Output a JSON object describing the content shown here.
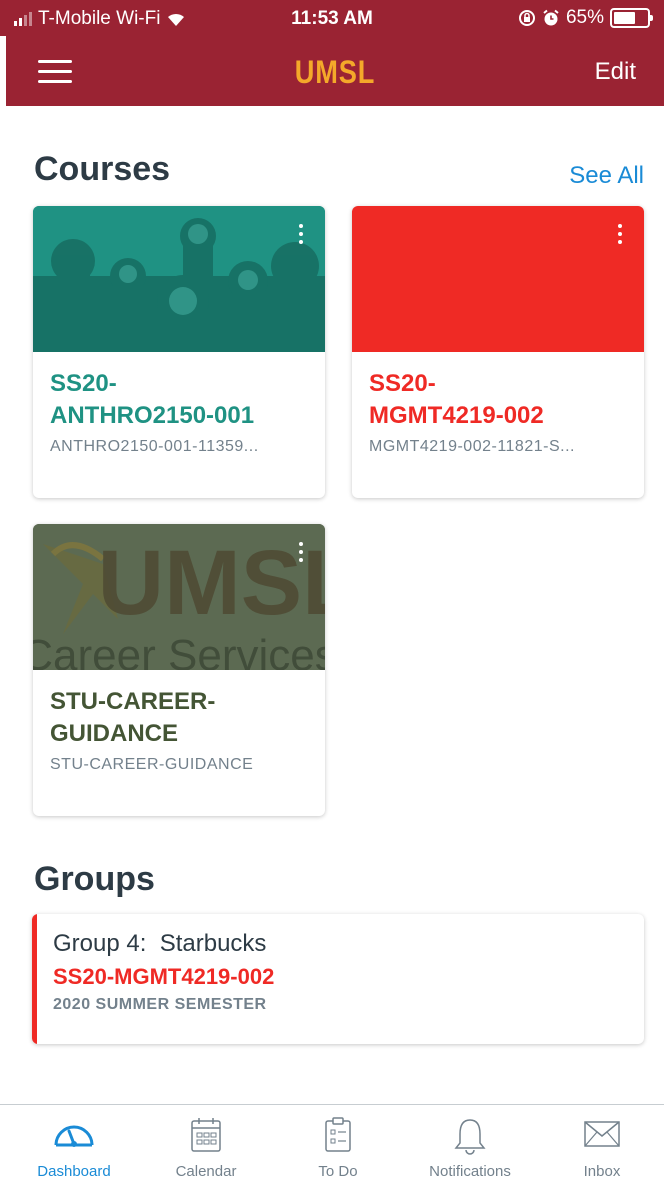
{
  "status_bar": {
    "carrier": "T-Mobile Wi-Fi",
    "time": "11:53 AM",
    "battery_percent": "65%",
    "battery_level": 0.65
  },
  "nav": {
    "brand": "UMSL",
    "edit_label": "Edit"
  },
  "courses_section": {
    "title": "Courses",
    "see_all_label": "See All",
    "cards": [
      {
        "title": "SS20-\nANTHRO2150-001",
        "subtitle": "ANTHRO2150-001-11359...",
        "color": "#1f9283"
      },
      {
        "title": "SS20-\nMGMT4219-002",
        "subtitle": "MGMT4219-002-11821-S...",
        "color": "#ef2a25"
      },
      {
        "title": "STU-CAREER-\nGUIDANCE",
        "subtitle": "STU-CAREER-GUIDANCE",
        "color": "#445535"
      }
    ]
  },
  "groups_section": {
    "title": "Groups",
    "groups": [
      {
        "name": "Group 4:  Starbucks",
        "course": "SS20-MGMT4219-002",
        "term": "2020 SUMMER SEMESTER",
        "color": "#ef2a25"
      }
    ]
  },
  "image_text": {
    "career_logo": "UMSL",
    "career_caption": "Career Services"
  },
  "tabs": [
    {
      "label": "Dashboard",
      "icon": "dashboard-gauge-icon",
      "active": true
    },
    {
      "label": "Calendar",
      "icon": "calendar-icon",
      "active": false
    },
    {
      "label": "To Do",
      "icon": "todo-clipboard-icon",
      "active": false
    },
    {
      "label": "Notifications",
      "icon": "bell-icon",
      "active": false
    },
    {
      "label": "Inbox",
      "icon": "envelope-icon",
      "active": false
    }
  ],
  "colors": {
    "header": "#9a2333",
    "brand": "#f4a82a",
    "link": "#1a8bd6",
    "active_tab": "#1a8bd6",
    "inactive_tab": "#73818c"
  }
}
